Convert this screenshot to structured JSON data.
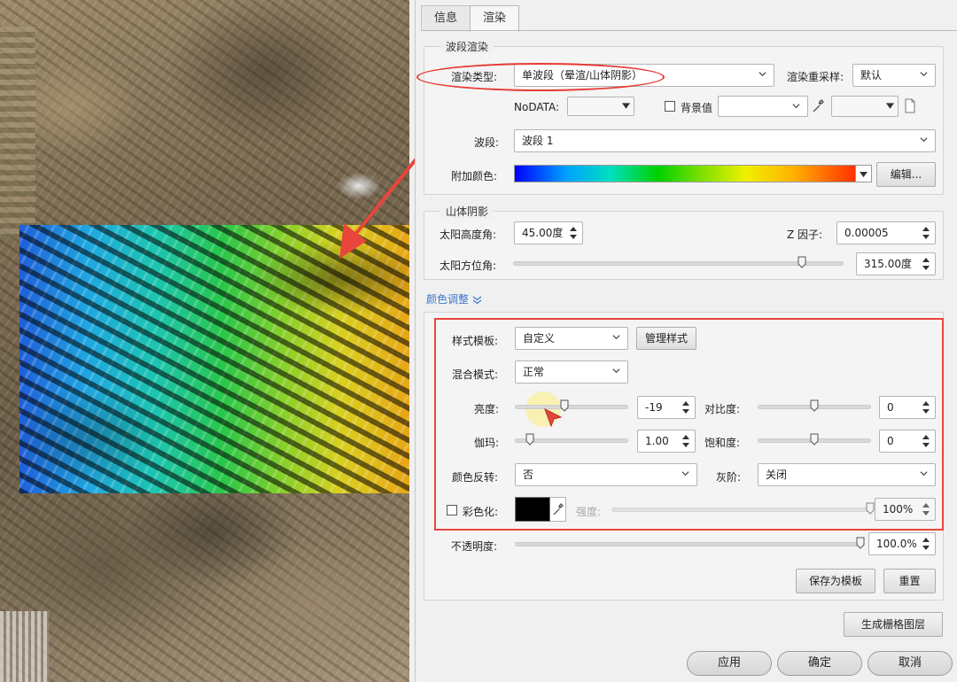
{
  "tabs": [
    {
      "label": "信息"
    },
    {
      "label": "渲染"
    }
  ],
  "band_render": {
    "group_title": "波段渲染",
    "render_type_label": "渲染类型:",
    "render_type_value": "单波段（晕渲/山体阴影）",
    "resample_label": "渲染重采样:",
    "resample_value": "默认",
    "nodata_label": "NoDATA:",
    "nodata_value": "",
    "background_label": "背景值",
    "background_checked": false,
    "band_label": "波段:",
    "band_value": "波段 1",
    "color_label": "附加颜色:",
    "edit_button": "编辑..."
  },
  "hillshade": {
    "group_title": "山体阴影",
    "altitude_label": "太阳高度角:",
    "altitude_value": "45.00度",
    "zfactor_label": "Z 因子:",
    "zfactor_value": "0.00005",
    "azimuth_label": "太阳方位角:",
    "azimuth_value": "315.00度",
    "azimuth_fraction": 0.875
  },
  "color_adjust": {
    "link_label": "颜色调整",
    "style_template_label": "样式模板:",
    "style_template_value": "自定义",
    "manage_button": "管理样式",
    "blend_label": "混合模式:",
    "blend_value": "正常",
    "brightness_label": "亮度:",
    "brightness_value": "-19",
    "brightness_fraction": 0.44,
    "contrast_label": "对比度:",
    "contrast_value": "0",
    "contrast_fraction": 0.5,
    "gamma_label": "伽玛:",
    "gamma_value": "1.00",
    "gamma_fraction": 0.13,
    "saturation_label": "饱和度:",
    "saturation_value": "0",
    "saturation_fraction": 0.5,
    "invert_label": "颜色反转:",
    "invert_value": "否",
    "grayscale_label": "灰阶:",
    "grayscale_value": "关闭",
    "colorize_label": "彩色化:",
    "colorize_checked": false,
    "strength_label": "强度:",
    "strength_value": "100%",
    "strength_fraction": 1.0,
    "opacity_label": "不透明度:",
    "opacity_value": "100.0%",
    "opacity_fraction": 1.0,
    "save_template_button": "保存为模板",
    "reset_button": "重置"
  },
  "generate_button": "生成栅格图层",
  "footer": {
    "apply": "应用",
    "ok": "确定",
    "cancel": "取消"
  },
  "colors": {
    "accent_red": "#e8453c",
    "link_blue": "#3c78c8",
    "colorize_swatch": "#000000"
  }
}
